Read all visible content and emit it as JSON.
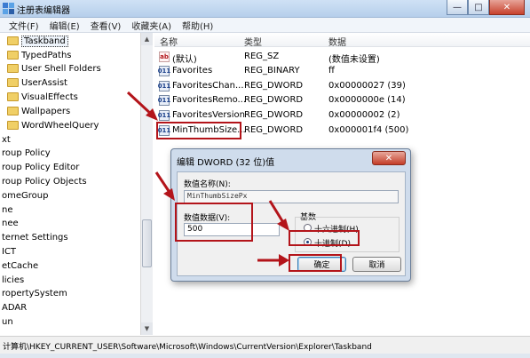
{
  "window": {
    "title": "注册表编辑器",
    "buttons": {
      "minimize": "—",
      "maximize": "□",
      "close": "✕"
    }
  },
  "menu": [
    "文件(F)",
    "编辑(E)",
    "查看(V)",
    "收藏夹(A)",
    "帮助(H)"
  ],
  "tree": {
    "items": [
      {
        "label": "Taskband",
        "selected": true
      },
      {
        "label": "TypedPaths"
      },
      {
        "label": "User Shell Folders"
      },
      {
        "label": "UserAssist"
      },
      {
        "label": "VisualEffects"
      },
      {
        "label": "Wallpapers"
      },
      {
        "label": "WordWheelQuery"
      },
      {
        "label": "xt"
      },
      {
        "label": "roup Policy"
      },
      {
        "label": "roup Policy Editor"
      },
      {
        "label": "roup Policy Objects"
      },
      {
        "label": "omeGroup"
      },
      {
        "label": "ne"
      },
      {
        "label": "nee"
      },
      {
        "label": "ternet Settings"
      },
      {
        "label": "ICT"
      },
      {
        "label": "etCache"
      },
      {
        "label": "licies"
      },
      {
        "label": "ropertySystem"
      },
      {
        "label": "ADAR"
      },
      {
        "label": "un"
      }
    ]
  },
  "list": {
    "columns": [
      "名称",
      "类型",
      "数据"
    ],
    "rows": [
      {
        "icon": "ab",
        "name": "(默认)",
        "type": "REG_SZ",
        "data": "(数值未设置)"
      },
      {
        "icon": "011",
        "name": "Favorites",
        "type": "REG_BINARY",
        "data": "ff"
      },
      {
        "icon": "011",
        "name": "FavoritesChan...",
        "type": "REG_DWORD",
        "data": "0x00000027 (39)"
      },
      {
        "icon": "011",
        "name": "FavoritesRemo...",
        "type": "REG_DWORD",
        "data": "0x0000000e (14)"
      },
      {
        "icon": "011",
        "name": "FavoritesVersion",
        "type": "REG_DWORD",
        "data": "0x00000002 (2)"
      },
      {
        "icon": "011",
        "name": "MinThumbSize...",
        "type": "REG_DWORD",
        "data": "0x000001f4 (500)"
      }
    ]
  },
  "dialog": {
    "title": "编辑 DWORD (32 位)值",
    "close": "✕",
    "value_name_label": "数值名称(N):",
    "value_name": "MinThumbSizePx",
    "value_data_label": "数值数据(V):",
    "value_data": "500",
    "base_label": "基数",
    "hex_label": "十六进制(H)",
    "dec_label": "十进制(D)",
    "ok": "确定",
    "cancel": "取消"
  },
  "status": {
    "path": "计算机\\HKEY_CURRENT_USER\\Software\\Microsoft\\Windows\\CurrentVersion\\Explorer\\Taskband"
  },
  "colors": {
    "annotation": "#b3141a",
    "title_bar": "#c2d7f0"
  }
}
